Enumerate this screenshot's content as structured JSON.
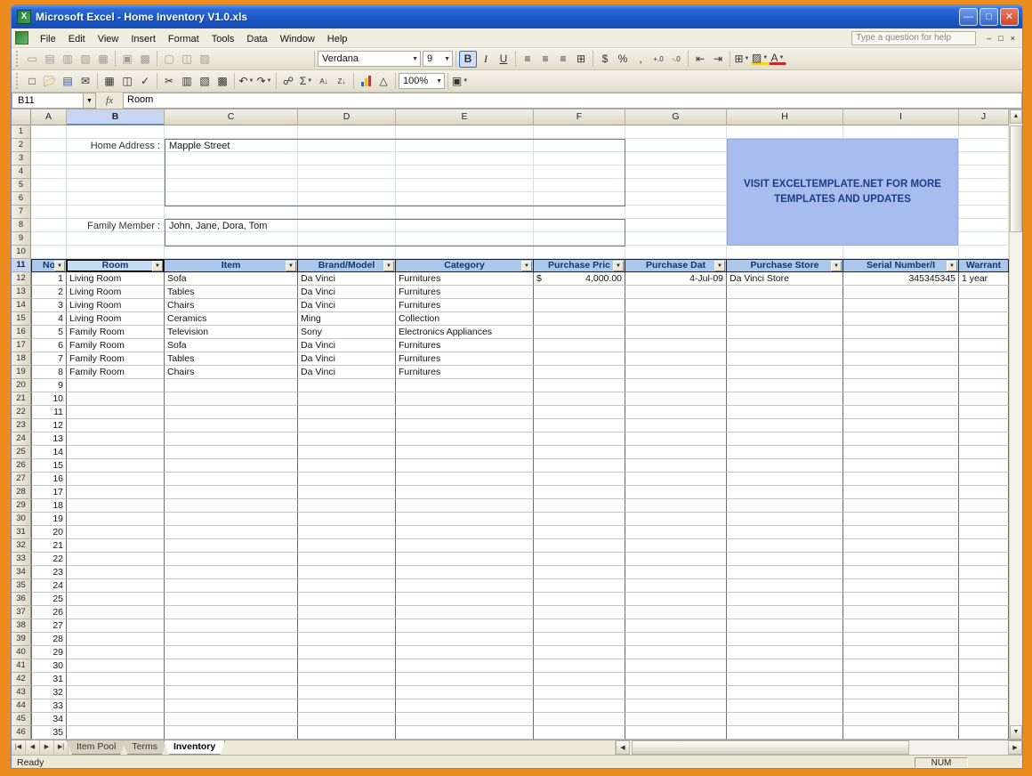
{
  "title_bar": {
    "title": "Microsoft Excel - Home Inventory V1.0.xls"
  },
  "menu_bar": {
    "items": [
      "File",
      "Edit",
      "View",
      "Insert",
      "Format",
      "Tools",
      "Data",
      "Window",
      "Help"
    ],
    "question_box": "Type a question for help"
  },
  "toolbars": {
    "font_name": "Verdana",
    "font_size": "9",
    "zoom_level": "100%"
  },
  "formula_bar": {
    "cell_reference": "B11",
    "fx_label": "fx",
    "value": "Room"
  },
  "grid": {
    "column_letters": [
      "A",
      "B",
      "C",
      "D",
      "E",
      "F",
      "G",
      "H",
      "I",
      "J"
    ],
    "selected_column": "B",
    "selected_row": 11,
    "row_count": 46,
    "home_address_label": "Home Address :",
    "home_address_value": "Mapple Street",
    "family_member_label": "Family Member :",
    "family_member_value": "John, Jane, Dora, Tom",
    "banner_text": "VISIT EXCELTEMPLATE.NET FOR MORE TEMPLATES AND UPDATES",
    "table": {
      "headers": [
        "No",
        "Room",
        "Item",
        "Brand/Model",
        "Category",
        "Purchase Pric",
        "Purchase Dat",
        "Purchase Store",
        "Serial Number/I",
        "Warrant"
      ],
      "data_rows": [
        {
          "no": "1",
          "room": "Living Room",
          "item": "Sofa",
          "brand_model": "Da Vinci",
          "category": "Furnitures",
          "purchase_price_currency": "$",
          "purchase_price": "4,000.00",
          "purchase_date": "4-Jul-09",
          "purchase_store": "Da Vinci Store",
          "serial_number": "345345345",
          "warranty": "1 year"
        },
        {
          "no": "2",
          "room": "Living Room",
          "item": "Tables",
          "brand_model": "Da Vinci",
          "category": "Furnitures"
        },
        {
          "no": "3",
          "room": "Living Room",
          "item": "Chairs",
          "brand_model": "Da Vinci",
          "category": "Furnitures"
        },
        {
          "no": "4",
          "room": "Living Room",
          "item": "Ceramics",
          "brand_model": "Ming",
          "category": "Collection"
        },
        {
          "no": "5",
          "room": "Family Room",
          "item": "Television",
          "brand_model": "Sony",
          "category": "Electronics Appliances"
        },
        {
          "no": "6",
          "room": "Family Room",
          "item": "Sofa",
          "brand_model": "Da Vinci",
          "category": "Furnitures"
        },
        {
          "no": "7",
          "room": "Family Room",
          "item": "Tables",
          "brand_model": "Da Vinci",
          "category": "Furnitures"
        },
        {
          "no": "8",
          "room": "Family Room",
          "item": "Chairs",
          "brand_model": "Da Vinci",
          "category": "Furnitures"
        }
      ],
      "empty_row_numbers": [
        9,
        10,
        11,
        12,
        13,
        14,
        15,
        16,
        17,
        18,
        19,
        20,
        21,
        22,
        23,
        24,
        25,
        26,
        27,
        28,
        29,
        30,
        31,
        32,
        33,
        34,
        35
      ]
    }
  },
  "sheet_tabs": {
    "items": [
      "Item Pool",
      "Terms",
      "Inventory"
    ],
    "active": "Inventory"
  },
  "status_bar": {
    "mode": "Ready",
    "num_lock": "NUM"
  },
  "colors": {
    "frame": "#ec8b1e",
    "title_bar": "#1d59c8",
    "banner_bg": "#a9bcee",
    "banner_text": "#1e3c87",
    "table_header_bg": "#abc7e9",
    "table_header_text": "#15366b",
    "selected_header_bg": "#c6d6f2"
  }
}
